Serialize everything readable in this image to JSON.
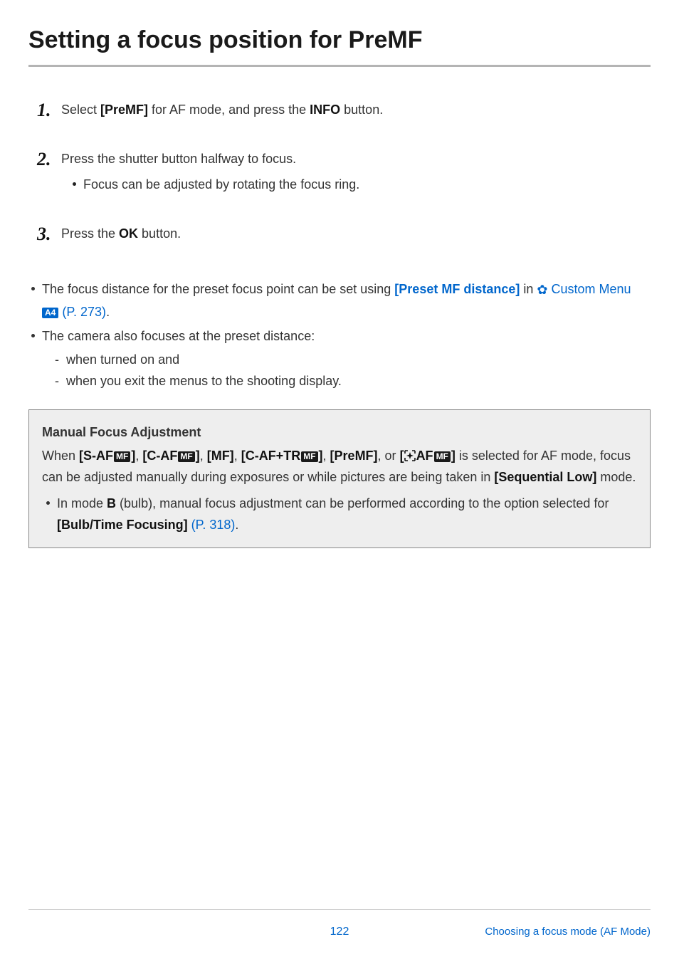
{
  "title": "Setting a focus position for PreMF",
  "steps": [
    {
      "num": "1.",
      "html": "Select <b>[PreMF]</b> for AF mode, and press the <b>INFO</b> button.",
      "sub": null
    },
    {
      "num": "2.",
      "html": "Press the shutter button halfway to focus.",
      "sub": "Focus can be adjusted by rotating the focus ring."
    },
    {
      "num": "3.",
      "html": "Press the <b>OK</b> button.",
      "sub": null
    }
  ],
  "notes": {
    "n1_part1": "The focus distance for the preset focus point can be set using ",
    "n1_link1": "[Preset MF distance]",
    "n1_part2": " in ",
    "n1_link2_prefix": " Custom Menu ",
    "n1_badge": "A4",
    "n1_link2_suffix": " (P. 273)",
    "n1_period": ".",
    "n2": "The camera also focuses at the preset distance:",
    "dashes": [
      "when turned on and",
      "when you exit the menus to the shooting display."
    ]
  },
  "callout": {
    "title": "Manual Focus Adjustment",
    "line_parts": {
      "p1": "When ",
      "b1": "[S-AF",
      "mf1": "MF",
      "b1b": "]",
      "c1": ", ",
      "b2": "[C-AF",
      "mf2": "MF",
      "b2b": "]",
      "c2": ", ",
      "b3": "[MF]",
      "c3": ", ",
      "b4": "[C-AF+TR",
      "mf4": "MF",
      "b4b": "]",
      "c4": ", ",
      "b5": "[PreMF]",
      "c5": ", or ",
      "b6pre": "[",
      "b6af": "AF",
      "mf6": "MF",
      "b6b": "]",
      "p2": " is selected for AF mode, focus can be adjusted manually during exposures or while pictures are being taken in ",
      "b7": "[Sequential Low]",
      "p3": " mode."
    },
    "bullet_parts": {
      "p1": "In mode ",
      "bB": "B",
      "p2": " (bulb), manual focus adjustment can be performed according to the option selected for ",
      "link": "[Bulb/Time Focusing]",
      "ref": " (P. 318)",
      "period": "."
    }
  },
  "footer": {
    "page": "122",
    "crumb": "Choosing a focus mode (AF Mode)"
  }
}
